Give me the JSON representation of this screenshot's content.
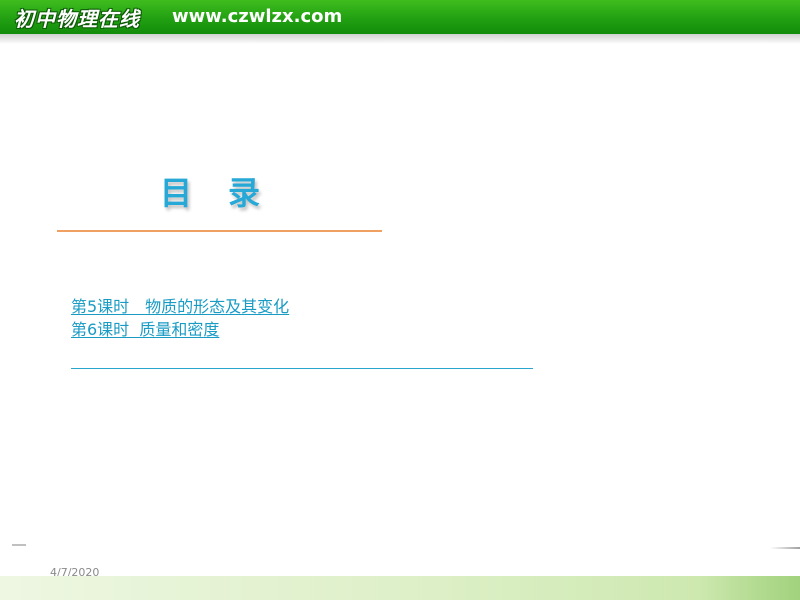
{
  "banner": {
    "logo_text": "初中物理在线",
    "url": "www.czwlzx.com",
    "color": "#22a012"
  },
  "title": {
    "char1": "目",
    "char2": "录",
    "color": "#27a9d8"
  },
  "toc": {
    "items": [
      {
        "label": "第5课时　物质的形态及其变化"
      },
      {
        "label": "第6课时  质量和密度"
      }
    ],
    "link_color": "#1a9bc4"
  },
  "footer": {
    "date": "4/7/2020"
  }
}
